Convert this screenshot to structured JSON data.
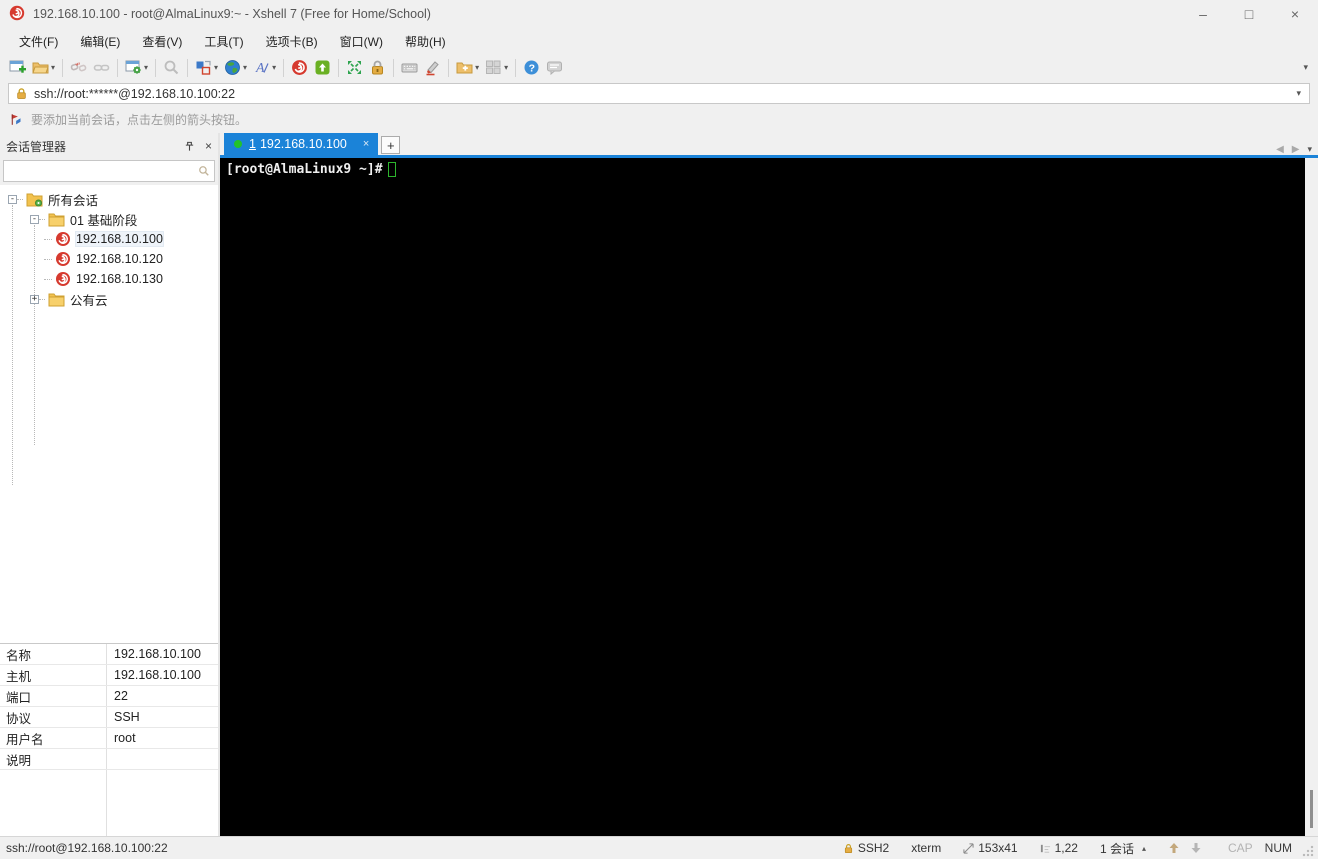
{
  "colors": {
    "accent_blue": "#1b83d8",
    "terminal_bg": "#000000",
    "terminal_text": "#efefef",
    "cursor_green": "#2db52d",
    "tab_dot_green": "#22c32a",
    "logo_red": "#d63a2f",
    "folder_yellow": "#f2c24e",
    "lock_gold": "#dfa938",
    "chrome_gray": "#f0f0f0"
  },
  "glyphs": {
    "dropdown": "▾",
    "up_small": "▴",
    "close_x": "×",
    "minus": "-",
    "plus": "+",
    "nav_left": "◀",
    "nav_right": "▶",
    "pin": "⏉"
  },
  "title_bar": {
    "title": "192.168.10.100 - root@AlmaLinux9:~ - Xshell 7 (Free for Home/School)"
  },
  "window_controls": {
    "minimize": "–",
    "maximize": "□",
    "close": "×"
  },
  "menu": {
    "items": [
      {
        "label": "文件(F)"
      },
      {
        "label": "编辑(E)"
      },
      {
        "label": "查看(V)"
      },
      {
        "label": "工具(T)"
      },
      {
        "label": "选项卡(B)"
      },
      {
        "label": "窗口(W)"
      },
      {
        "label": "帮助(H)"
      }
    ]
  },
  "address_bar": {
    "value": "ssh://root:******@192.168.10.100:22"
  },
  "info_bar": {
    "message": "要添加当前会话，点击左侧的箭头按钮。"
  },
  "session_panel": {
    "title": "会话管理器",
    "search_value": "",
    "tree": {
      "root": "所有会话",
      "group1": "01 基础阶段",
      "session1": "192.168.10.100",
      "session2": "192.168.10.120",
      "session3": "192.168.10.130",
      "group2": "公有云"
    },
    "properties": [
      {
        "label": "名称",
        "value": "192.168.10.100"
      },
      {
        "label": "主机",
        "value": "192.168.10.100"
      },
      {
        "label": "端口",
        "value": "22"
      },
      {
        "label": "协议",
        "value": "SSH"
      },
      {
        "label": "用户名",
        "value": "root"
      },
      {
        "label": "说明",
        "value": ""
      }
    ]
  },
  "tab_bar": {
    "active_tab": {
      "number": "1",
      "label": "192.168.10.100"
    },
    "new_tab": "+"
  },
  "terminal": {
    "prompt": "[root@AlmaLinux9 ~]#"
  },
  "status_bar": {
    "left": "ssh://root@192.168.10.100:22",
    "protocol": "SSH2",
    "terminal_type": "xterm",
    "screen_size": "153x41",
    "cursor_pos": "1,22",
    "session_count": "1 会话",
    "caps": "CAP",
    "num": "NUM"
  }
}
